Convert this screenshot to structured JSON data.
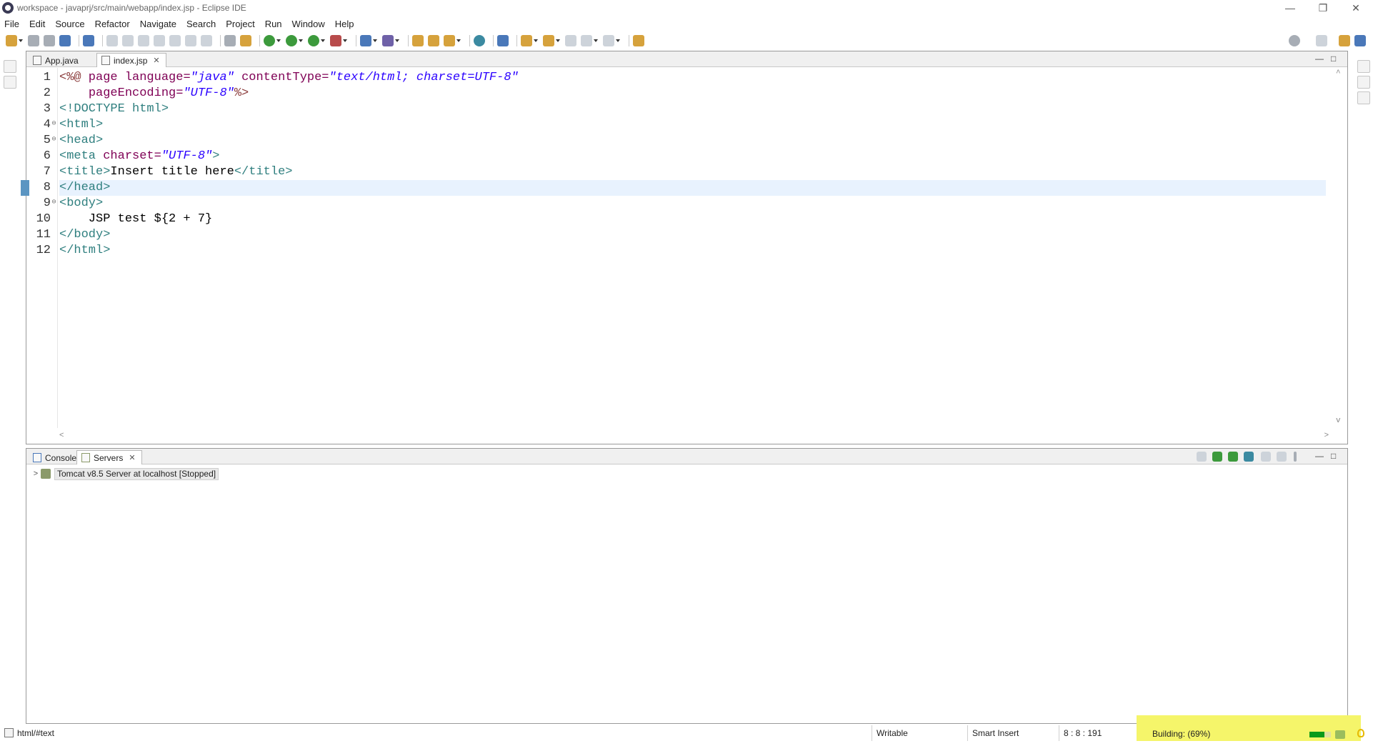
{
  "window": {
    "title": "workspace - javaprj/src/main/webapp/index.jsp - Eclipse IDE",
    "controls": {
      "minimize": "—",
      "restore": "❐",
      "close": "✕"
    }
  },
  "menu": [
    "File",
    "Edit",
    "Source",
    "Refactor",
    "Navigate",
    "Search",
    "Project",
    "Run",
    "Window",
    "Help"
  ],
  "editor": {
    "tabs": [
      {
        "label": "App.java",
        "active": false
      },
      {
        "label": "index.jsp",
        "active": true,
        "close": "✕"
      }
    ],
    "panel_controls": {
      "minimize": "—",
      "maximize": "□"
    },
    "lines": [
      {
        "n": "1",
        "fold": ""
      },
      {
        "n": "2",
        "fold": ""
      },
      {
        "n": "3",
        "fold": ""
      },
      {
        "n": "4",
        "fold": "⊖"
      },
      {
        "n": "5",
        "fold": "⊖"
      },
      {
        "n": "6",
        "fold": ""
      },
      {
        "n": "7",
        "fold": ""
      },
      {
        "n": "8",
        "fold": ""
      },
      {
        "n": "9",
        "fold": "⊖"
      },
      {
        "n": "10",
        "fold": ""
      },
      {
        "n": "11",
        "fold": ""
      },
      {
        "n": "12",
        "fold": ""
      }
    ],
    "code": {
      "l1": {
        "open": "<%@",
        "kw": " page ",
        "a1": "language=",
        "v1": "\"java\"",
        "a2": " contentType=",
        "v2": "\"text/html; charset=UTF-8\""
      },
      "l2": {
        "indent": "    ",
        "a1": "pageEncoding=",
        "v1": "\"UTF-8\"",
        "close": "%>"
      },
      "l3": {
        "text": "<!DOCTYPE html>"
      },
      "l4": {
        "text": "<html>"
      },
      "l5": {
        "text": "<head>"
      },
      "l6": {
        "open": "<meta ",
        "a1": "charset=",
        "v1": "\"UTF-8\"",
        "close": ">"
      },
      "l7": {
        "open": "<title>",
        "text": "Insert title here",
        "close": "</title>"
      },
      "l8": {
        "text": "</head>"
      },
      "l9": {
        "text": "<body>"
      },
      "l10": {
        "text": "    JSP test ${2 + 7}"
      },
      "l11": {
        "text": "</body>"
      },
      "l12": {
        "text": "</html>"
      }
    },
    "current_line": 8,
    "scroll_arrows": {
      "up": "^",
      "down": "v",
      "left": "<",
      "right": ">"
    }
  },
  "bottom_panel": {
    "tabs": [
      {
        "label": "Console",
        "active": false
      },
      {
        "label": "Servers",
        "active": true,
        "close": "✕"
      }
    ],
    "tree": [
      {
        "twisty": ">",
        "label": "Tomcat v8.5 Server at localhost  [Stopped]"
      }
    ]
  },
  "status": {
    "context": "html/#text",
    "writable": "Writable",
    "insert_mode": "Smart Insert",
    "position": "8 : 8 : 191",
    "progress_label": "Building: (69%)",
    "progress_value": 0.69
  },
  "colors": {
    "progress_highlight": "#f5f56a",
    "progress_fill": "#0a9a1a",
    "current_line": "#e8f2fe",
    "tag": "#2f7f7f",
    "attribute": "#7f0055",
    "string": "#2a00ff"
  }
}
